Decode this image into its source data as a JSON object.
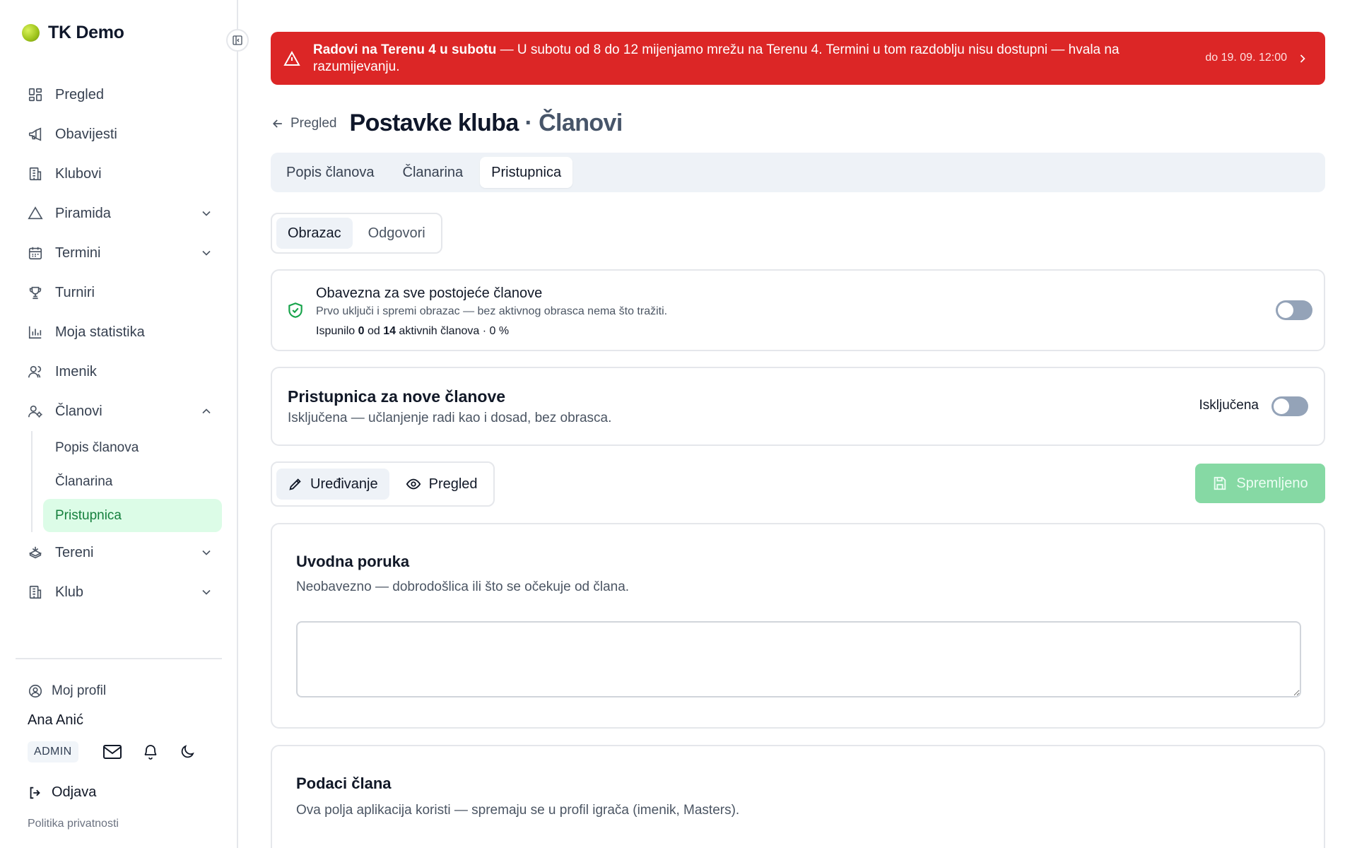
{
  "brand": {
    "name": "TK Demo"
  },
  "sidebar": {
    "items": [
      {
        "label": "Pregled",
        "icon": "dashboard-icon"
      },
      {
        "label": "Obavijesti",
        "icon": "megaphone-icon"
      },
      {
        "label": "Klubovi",
        "icon": "building-icon"
      },
      {
        "label": "Piramida",
        "icon": "triangle-icon",
        "expandable": true
      },
      {
        "label": "Termini",
        "icon": "calendar-icon",
        "expandable": true
      },
      {
        "label": "Turniri",
        "icon": "trophy-icon"
      },
      {
        "label": "Moja statistika",
        "icon": "bar-chart-icon"
      },
      {
        "label": "Imenik",
        "icon": "users-icon"
      },
      {
        "label": "Članovi",
        "icon": "user-cog-icon",
        "expanded": true
      },
      {
        "label": "Tereni",
        "icon": "court-icon",
        "expandable": true
      },
      {
        "label": "Klub",
        "icon": "building-icon",
        "expandable": true
      }
    ],
    "sub_items": [
      {
        "label": "Popis članova"
      },
      {
        "label": "Članarina"
      },
      {
        "label": "Pristupnica",
        "active": true
      }
    ],
    "profile_link": "Moj profil",
    "user_name": "Ana Anić",
    "role_badge": "ADMIN",
    "logout": "Odjava",
    "privacy": "Politika privatnosti"
  },
  "banner": {
    "title": "Radovi na Terenu 4 u subotu",
    "message": " — U subotu od 8 do 12 mijenjamo mrežu na Terenu 4. Termini u tom razdoblju nisu dostupni — hvala na razumijevanju.",
    "until": "do 19. 09. 12:00",
    "color": "#dc2626"
  },
  "header": {
    "back_label": "Pregled",
    "title": "Postavke kluba",
    "subtitle": " · Članovi"
  },
  "tabs": [
    "Popis članova",
    "Članarina",
    "Pristupnica"
  ],
  "form_tabs": [
    "Obrazac",
    "Odgovori"
  ],
  "mandatory": {
    "title": "Obavezna za sve postojeće članove",
    "description": "Prvo uključi i spremi obrazac — bez aktivnog obrasca nema što tražiti.",
    "stats_prefix": "Ispunilo ",
    "filled": "0",
    "stats_mid": " od ",
    "total": "14",
    "stats_suffix": " aktivnih članova · 0 %",
    "enabled": false
  },
  "new_members": {
    "title": "Pristupnica za nove članove",
    "description": "Isključena — učlanjenje radi kao i dosad, bez obrasca.",
    "state_label": "Isključena",
    "enabled": false
  },
  "editor_modes": [
    "Uređivanje",
    "Pregled"
  ],
  "save_button": "Spremljeno",
  "intro_section": {
    "title": "Uvodna poruka",
    "description": "Neobavezno — dobrodošlica ili što se očekuje od člana.",
    "value": ""
  },
  "member_data_section": {
    "title": "Podaci člana",
    "description": "Ova polja aplikacija koristi — spremaju se u profil igrača (imenik, Masters)."
  },
  "colors": {
    "accent": "#16a34a",
    "active_bg": "#dcfce7",
    "danger": "#dc2626",
    "save_disabled": "#86d9a4"
  }
}
